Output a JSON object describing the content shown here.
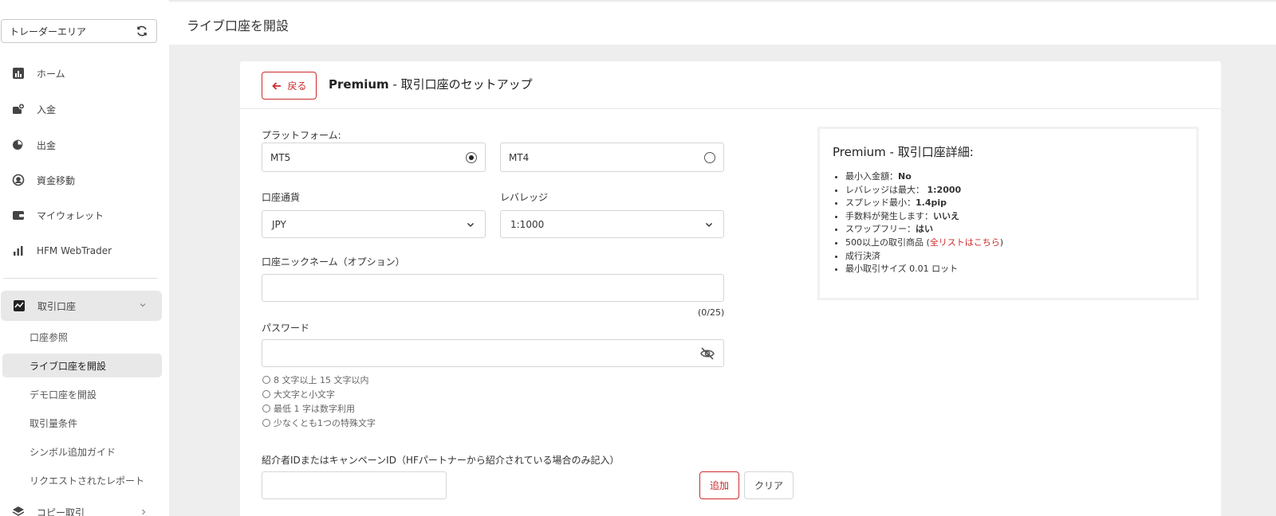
{
  "sidebar": {
    "trader_area": "トレーダーエリア",
    "items": [
      {
        "label": "ホーム",
        "icon": "bar-chart-icon"
      },
      {
        "label": "入金",
        "icon": "deposit-icon"
      },
      {
        "label": "出金",
        "icon": "withdraw-icon"
      },
      {
        "label": "資金移動",
        "icon": "transfer-icon"
      },
      {
        "label": "マイウォレット",
        "icon": "wallet-icon"
      },
      {
        "label": "HFM WebTrader",
        "icon": "webtrader-icon"
      }
    ],
    "accounts": {
      "label": "取引口座",
      "icon": "trading-account-icon"
    },
    "sub_items": [
      "口座参照",
      "ライブ口座を開設",
      "デモ口座を開設",
      "取引量条件",
      "シンボル追加ガイド",
      "リクエストされたレポート"
    ],
    "copy_trading": "コピー取引"
  },
  "header": {
    "title": "ライブ口座を開設"
  },
  "card": {
    "back_label": "戻る",
    "title_bold": "Premium",
    "title_rest": " - 取引口座のセットアップ",
    "platform_label": "プラットフォーム:",
    "platforms": [
      {
        "label": "MT5",
        "selected": true
      },
      {
        "label": "MT4",
        "selected": false
      }
    ],
    "currency_label": "口座通貨",
    "currency_value": "JPY",
    "leverage_label": "レバレッジ",
    "leverage_value": "1:1000",
    "nickname_label": "口座ニックネーム（オプション）",
    "nickname_counter": "(0/25)",
    "password_label": "パスワード",
    "password_rules": [
      "8 文字以上 15 文字以内",
      "大文字と小文字",
      "最低 1 字は数字利用",
      "少なくとも1つの特殊文字"
    ],
    "referral_label": "紹介者IDまたはキャンペーンID（HFパートナーから紹介されている場合のみ記入）",
    "add_label": "追加",
    "clear_label": "クリア"
  },
  "details": {
    "title": "Premium - 取引口座詳細:",
    "min_deposit_label": "最小入金額：",
    "min_deposit_value": "No",
    "leverage_label": "レバレッジは最大：",
    "leverage_value": "1:2000",
    "spread_label": "スプレッド最小：",
    "spread_value": "1.4pip",
    "commission_label": "手数料が発生します：",
    "commission_value": "いいえ",
    "swapfree_label": "スワップフリー：",
    "swapfree_value": "はい",
    "instruments_pre": "500以上の取引商品 (",
    "instruments_link": "全リストはこちら",
    "instruments_post": ")",
    "execution": "成行決済",
    "min_lot": "最小取引サイズ 0.01 ロット"
  },
  "colors": {
    "accent": "#cf2b2b",
    "sidebar_active": "#e8e8e8",
    "background": "#eeeeee"
  }
}
